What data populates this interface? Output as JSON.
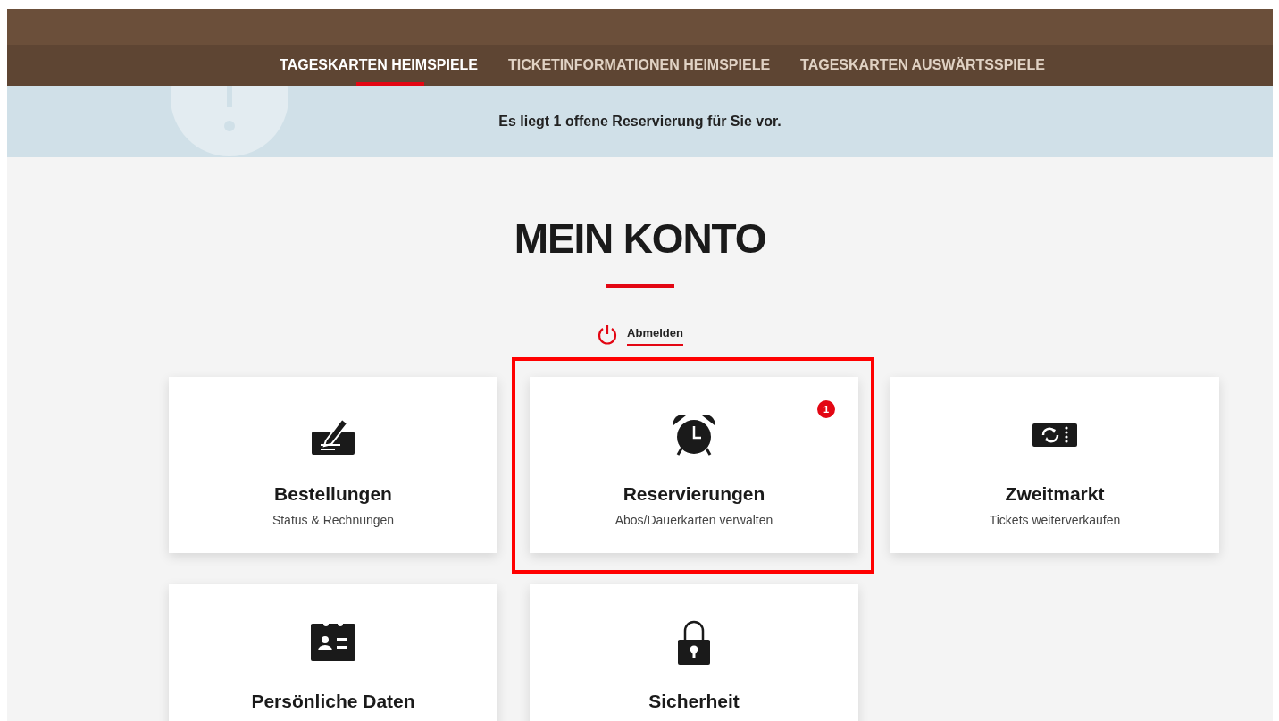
{
  "nav": {
    "tabs": [
      {
        "label": "TAGESKARTEN HEIMSPIELE",
        "selected": true
      },
      {
        "label": "TICKETINFORMATIONEN HEIMSPIELE",
        "selected": false
      },
      {
        "label": "TAGESKARTEN AUSWÄRTSSPIELE",
        "selected": false
      }
    ]
  },
  "notice": {
    "text": "Es liegt 1 offene Reservierung für Sie vor."
  },
  "heading": "MEIN KONTO",
  "logout": {
    "label": "Abmelden"
  },
  "cards": [
    {
      "kind": "orders",
      "title": "Bestellungen",
      "subtitle": "Status & Rechnungen",
      "highlighted": false
    },
    {
      "kind": "reservations",
      "title": "Reservierungen",
      "subtitle": "Abos/Dauerkarten verwalten",
      "badge": "1",
      "highlighted": true
    },
    {
      "kind": "resale",
      "title": "Zweitmarkt",
      "subtitle": "Tickets weiterverkaufen",
      "highlighted": false
    },
    {
      "kind": "profile",
      "title": "Persönliche Daten",
      "highlighted": false
    },
    {
      "kind": "security",
      "title": "Sicherheit",
      "highlighted": false
    }
  ]
}
